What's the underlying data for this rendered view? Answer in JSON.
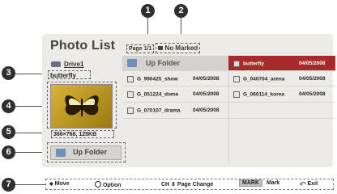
{
  "screen": {
    "title": "Photo List",
    "page_indicator": "Page 1/1",
    "marked_status": "No Marked",
    "drive_label": "Drive1",
    "selected_name": "butterfly",
    "image_info": "366×768, 125KB",
    "up_folder_label": "Up Folder"
  },
  "grid": {
    "up_folder_label": "Up Folder",
    "highlighted": {
      "name": "butterfly",
      "date": "04/05/2008"
    },
    "items": [
      {
        "name": "G_990425_show",
        "date": "04/05/2008"
      },
      {
        "name": "G_040704_arena",
        "date": "04/05/2008"
      },
      {
        "name": "G_051224_dome",
        "date": "04/05/2008"
      },
      {
        "name": "G_060114_korea",
        "date": "04/05/2008"
      },
      {
        "name": "G_070107_drama",
        "date": "04/05/2008"
      }
    ]
  },
  "bottom_bar": {
    "move": "Move",
    "option": "Option",
    "ch": "CH",
    "page_change": "Page Change",
    "mark_key": "MARK",
    "mark": "Mark",
    "exit": "Exit"
  },
  "callouts": [
    "1",
    "2",
    "3",
    "4",
    "5",
    "6",
    "7"
  ],
  "colors": {
    "highlight": "#a82a2a",
    "callout": "#2f2f2f"
  }
}
